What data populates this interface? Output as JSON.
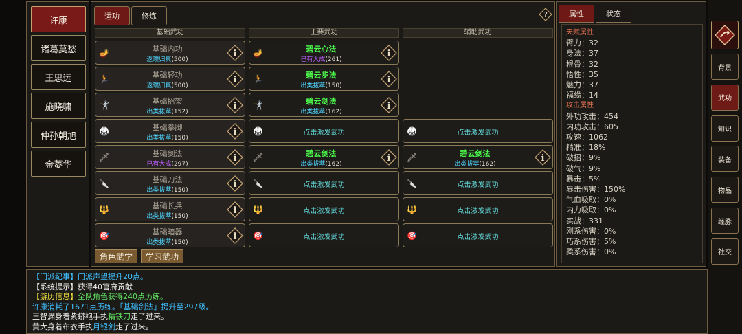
{
  "characters": [
    "许康",
    "诸葛莫愁",
    "王思远",
    "施晓啸",
    "仲孙朝旭",
    "金菱华"
  ],
  "selected_character": "许康",
  "tabs": {
    "active": "运功",
    "other": "修炼"
  },
  "columns": {
    "base": "基础武功",
    "main": "主要武功",
    "aux": "辅助武功"
  },
  "base_skills": [
    {
      "name": "基础内功",
      "rank": "返璞归真",
      "level": "(500)",
      "icon": "🪔"
    },
    {
      "name": "基础轻功",
      "rank": "返璞归真",
      "level": "(500)",
      "icon": "🏃"
    },
    {
      "name": "基础招架",
      "rank": "出类拔萃",
      "level": "(152)",
      "icon": "🤺"
    },
    {
      "name": "基础拳脚",
      "rank": "出类拔萃",
      "level": "(150)",
      "icon": "🥋"
    },
    {
      "name": "基础剑法",
      "rank": "已有大成",
      "level": "(297)",
      "icon": "🗡"
    },
    {
      "name": "基础刀法",
      "rank": "出类拔萃",
      "level": "(150)",
      "icon": "🔪"
    },
    {
      "name": "基础长兵",
      "rank": "出类拔萃",
      "level": "(150)",
      "icon": "🔱"
    },
    {
      "name": "基础暗器",
      "rank": "出类拔萃",
      "level": "(150)",
      "icon": "🎯"
    }
  ],
  "main_skills": [
    {
      "name": "碧云心法",
      "rank": "已有大成",
      "level": "(261)"
    },
    {
      "name": "碧云步法",
      "rank": "出类拔萃",
      "level": "(150)"
    },
    {
      "name": "碧云剑法",
      "rank": "出类拔萃",
      "level": "(162)"
    },
    {
      "call": "点击激发武功"
    },
    {
      "name": "碧云剑法",
      "rank": "出类拔萃",
      "level": "(162)"
    },
    {
      "call": "点击激发武功"
    },
    {
      "call": "点击激发武功"
    },
    {
      "call": "点击激发武功"
    }
  ],
  "aux_skills": [
    {
      "call": "点击激发武功"
    },
    {
      "name": "碧云剑法",
      "rank": "出类拔萃",
      "level": "(162)"
    },
    {
      "call": "点击激发武功"
    },
    {
      "call": "点击激发武功"
    },
    {
      "call": "点击激发武功"
    }
  ],
  "buttons": {
    "role_skills": "角色武学",
    "learn": "学习武功"
  },
  "stat_tabs": {
    "active": "属性",
    "other": "状态"
  },
  "stats": {
    "talent_header": "天赋属性",
    "talent": [
      "臂力：32",
      "身法：37",
      "根骨：32",
      "悟性：35",
      "魅力：37",
      "福缘：14"
    ],
    "attack_header": "攻击属性",
    "attack": [
      "外功攻击：454",
      "内功攻击：605",
      "攻速：1062",
      "精准：18%",
      "破招：9%",
      "破气：9%",
      "暴击：5%",
      "暴击伤害：150%",
      "气血吸取：0%",
      "内力吸取：0%",
      "实战：331",
      "刚系伤害：0%",
      "巧系伤害：5%",
      "柔系伤害：0%"
    ]
  },
  "side_menu": [
    "背景",
    "武功",
    "知识",
    "装备",
    "物品",
    "经脉",
    "社交"
  ],
  "side_active": "武功",
  "log": [
    {
      "parts": [
        {
          "t": "【门派纪事】",
          "c": "#3fc0ff"
        },
        {
          "t": "门派声望提升20点。",
          "c": "#3fc0ff"
        }
      ]
    },
    {
      "parts": [
        {
          "t": "【系统提示】",
          "c": "#f0f0f0"
        },
        {
          "t": "获得40官府贡献",
          "c": "#f0f0f0"
        }
      ]
    },
    {
      "parts": [
        {
          "t": "【游历信息】",
          "c": "#f0e040"
        },
        {
          "t": "全队角色获得240点历练。",
          "c": "#60e060"
        }
      ]
    },
    {
      "parts": [
        {
          "t": "许康消耗了1671点历练。「基础剑法」提升至297级。",
          "c": "#3fc0ff"
        }
      ]
    },
    {
      "parts": [
        {
          "t": "王智渊身着紫蟒袍手执",
          "c": "#f0f0f0"
        },
        {
          "t": "精铁刀",
          "c": "#60e060"
        },
        {
          "t": "走了过来。",
          "c": "#f0f0f0"
        }
      ]
    },
    {
      "parts": [
        {
          "t": "黄大身着布衣手执",
          "c": "#f0f0f0"
        },
        {
          "t": "月银剑",
          "c": "#3fc0ff"
        },
        {
          "t": "走了过来。",
          "c": "#f0f0f0"
        }
      ]
    }
  ],
  "colors": {
    "accent": "#6f1916",
    "green_name": "#4cff4c",
    "cyan_rank": "#4fd6ff",
    "purple_rank": "#c060ff"
  }
}
